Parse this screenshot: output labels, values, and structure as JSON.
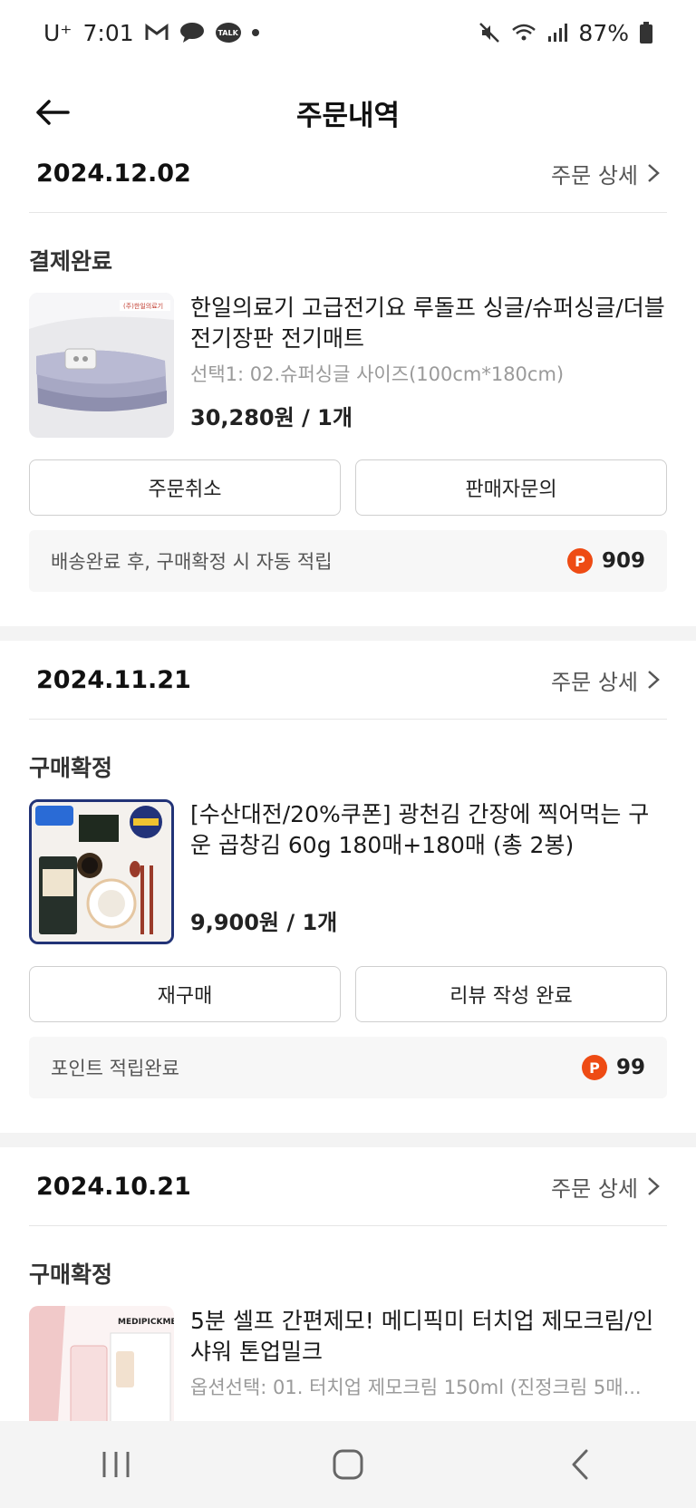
{
  "status_bar": {
    "carrier": "U⁺",
    "time": "7:01",
    "battery": "87%",
    "talk_label": "TALK"
  },
  "header": {
    "title": "주문내역"
  },
  "orders": [
    {
      "date": "2024.12.02",
      "detail_label": "주문 상세",
      "status": "결제완료",
      "product_name": "한일의료기 고급전기요 루돌프 싱글/슈퍼싱글/더블 전기장판 전기매트",
      "option": "선택1: 02.슈퍼싱글 사이즈(100cm*180cm)",
      "price": "30,280원 / 1개",
      "buttons": [
        "주문취소",
        "판매자문의"
      ],
      "point_text": "배송완료 후, 구매확정 시 자동 적립",
      "point_value": "909",
      "brand_label": "(주)한일의료기"
    },
    {
      "date": "2024.11.21",
      "detail_label": "주문 상세",
      "status": "구매확정",
      "product_name": "[수산대전/20%쿠폰] 광천김 간장에 찍어먹는 구운 곱창김 60g 180매+180매 (총 2봉)",
      "option": "",
      "price": "9,900원 / 1개",
      "buttons": [
        "재구매",
        "리뷰 작성 완료"
      ],
      "point_text": "포인트 적립완료",
      "point_value": "99"
    },
    {
      "date": "2024.10.21",
      "detail_label": "주문 상세",
      "status": "구매확정",
      "product_name": "5분 셀프 간편제모! 메디픽미 터치업 제모크림/인샤워 톤업밀크",
      "option": "옵션선택: 01. 터치업 제모크림 150ml (진정크림 5매...",
      "brand_label": "MEDIPICKME"
    }
  ],
  "point_badge": "P",
  "colors": {
    "accent": "#ee4b14",
    "divider": "#e6e6e6",
    "point_bg": "#f7f7f7"
  },
  "icons": [
    "back-arrow-icon",
    "chevron-right-icon",
    "gmail-icon",
    "chat-icon",
    "talk-icon",
    "mute-icon",
    "wifi-icon",
    "signal-icon",
    "battery-icon",
    "recent-apps-icon",
    "home-icon",
    "nav-back-icon"
  ]
}
